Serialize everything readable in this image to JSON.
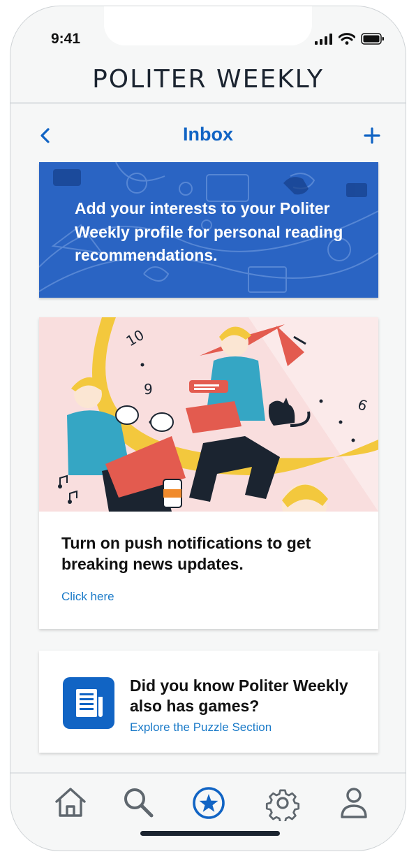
{
  "status": {
    "time": "9:41"
  },
  "header": {
    "brand": "POLITER WEEKLY",
    "title": "Inbox"
  },
  "icons": {
    "back": "chevron-left-icon",
    "add": "plus-icon"
  },
  "banner": {
    "text": "Add your interests to your Politer Weekly profile for personal reading recommendations."
  },
  "push_card": {
    "title": "Turn on push notifications to get breaking news updates.",
    "link": "Click here"
  },
  "games_card": {
    "title": "Did you know Politer Weekly also has games?",
    "link": "Explore the Puzzle Section"
  },
  "tabbar": {
    "tabs": [
      {
        "icon": "home-icon"
      },
      {
        "icon": "search-icon"
      },
      {
        "icon": "star-icon",
        "active": true
      },
      {
        "icon": "gear-icon"
      },
      {
        "icon": "user-icon"
      }
    ]
  },
  "colors": {
    "accent": "#1164c4",
    "link": "#1a7ac8",
    "banner": "#2a64c3",
    "tab_inactive": "#5f676e"
  }
}
